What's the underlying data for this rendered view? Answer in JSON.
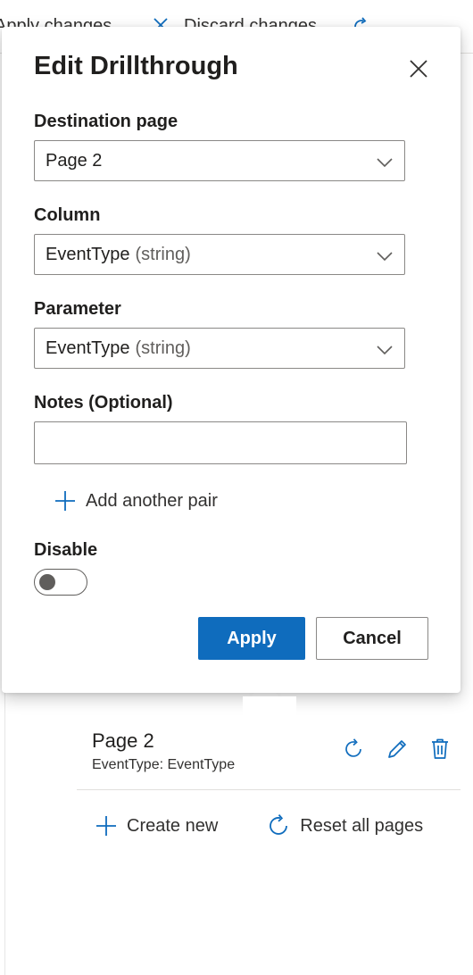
{
  "toolbar": {
    "apply_label": "Apply changes",
    "discard_label": "Discard changes",
    "more_label": "..."
  },
  "dialog": {
    "title": "Edit Drillthrough",
    "destination": {
      "label": "Destination page",
      "value": "Page 2"
    },
    "column": {
      "label": "Column",
      "value": "EventType",
      "type": "(string)"
    },
    "parameter": {
      "label": "Parameter",
      "value": "EventType",
      "type": "(string)"
    },
    "notes": {
      "label": "Notes (Optional)",
      "value": ""
    },
    "add_pair_label": "Add another pair",
    "disable": {
      "label": "Disable",
      "on": false
    },
    "apply_label": "Apply",
    "cancel_label": "Cancel"
  },
  "page_list": {
    "items": [
      {
        "name": "Page 2",
        "mapping": "EventType: EventType"
      }
    ],
    "create_label": "Create new",
    "reset_label": "Reset all pages"
  },
  "colors": {
    "accent": "#0f6cbd",
    "text": "#201f1e",
    "border": "#8a8886"
  }
}
